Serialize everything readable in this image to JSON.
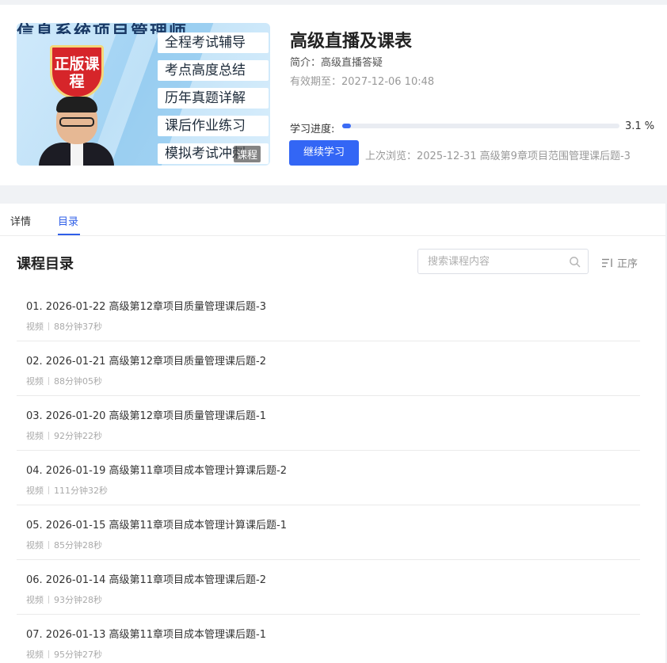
{
  "course": {
    "title": "高级直播及课表",
    "intro": "简介：高级直播答疑",
    "expiry": "有效期至：2027-12-06 10:48",
    "progress_label": "学习进度:",
    "progress_percent": 3.1,
    "progress_text": "3.1 %",
    "continue_label": "继续学习",
    "last_browse": "上次浏览：2025-12-31 高级第9章项目范围管理课后题-3"
  },
  "cover": {
    "banner_text": "信息系统项目管理师",
    "badge_text": "正版课程",
    "features": [
      "全程考试辅导",
      "考点高度总结",
      "历年真题详解",
      "课后作业练习",
      "模拟考试冲刺"
    ],
    "tag": "课程"
  },
  "tabs": [
    {
      "label": "详情",
      "active": false
    },
    {
      "label": "目录",
      "active": true
    }
  ],
  "catalog": {
    "title": "课程目录",
    "search_placeholder": "搜索课程内容",
    "sort_label": "正序"
  },
  "lessons": [
    {
      "title": "01.  2026-01-22 高级第12章项目质量管理课后题-3",
      "type": "视频",
      "duration": "88分钟37秒"
    },
    {
      "title": "02.  2026-01-21 高级第12章项目质量管理课后题-2",
      "type": "视频",
      "duration": "88分钟05秒"
    },
    {
      "title": "03.  2026-01-20 高级第12章项目质量管理课后题-1",
      "type": "视频",
      "duration": "92分钟22秒"
    },
    {
      "title": "04.  2026-01-19 高级第11章项目成本管理计算课后题-2",
      "type": "视频",
      "duration": "111分钟32秒"
    },
    {
      "title": "05.  2026-01-15 高级第11章项目成本管理计算课后题-1",
      "type": "视频",
      "duration": "85分钟28秒"
    },
    {
      "title": "06.  2026-01-14 高级第11章项目成本管理课后题-2",
      "type": "视频",
      "duration": "93分钟28秒"
    },
    {
      "title": "07.  2026-01-13 高级第11章项目成本管理课后题-1",
      "type": "视频",
      "duration": "95分钟27秒"
    }
  ],
  "colors": {
    "accent": "#3366f5",
    "tab_active": "#2f5fe8"
  }
}
